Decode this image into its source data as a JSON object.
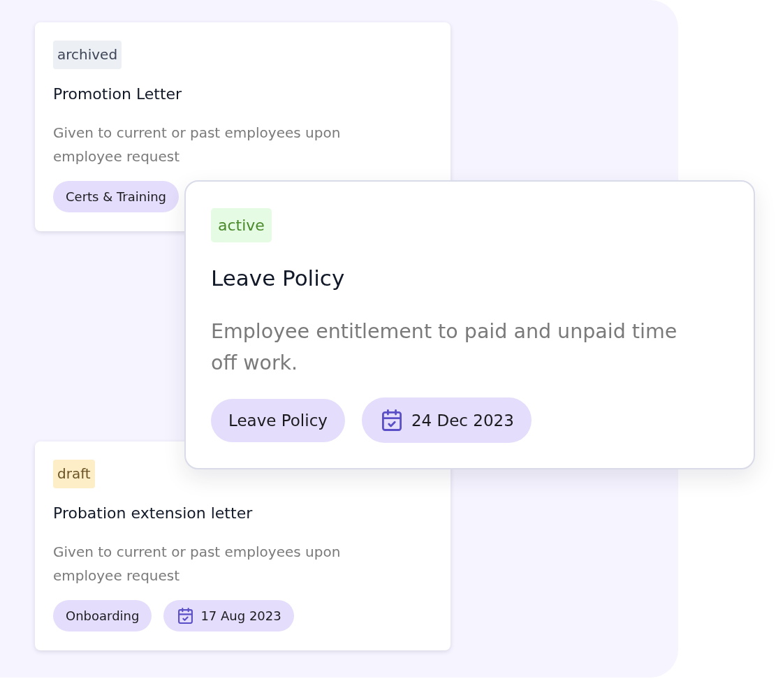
{
  "cards": [
    {
      "kind": "compact",
      "status": {
        "label": "archived",
        "kind": "neutral"
      },
      "title": "Promotion Letter",
      "description": "Given to current or past employees upon employee request",
      "tags": [
        {
          "kind": "category",
          "label": "Certs & Training"
        }
      ]
    },
    {
      "kind": "popout",
      "status": {
        "label": "active",
        "kind": "success"
      },
      "title": "Leave Policy",
      "description": "Employee entitlement to paid and unpaid time off work.",
      "tags": [
        {
          "kind": "category",
          "label": "Leave Policy"
        },
        {
          "kind": "date",
          "label": "24 Dec 2023"
        }
      ]
    },
    {
      "kind": "compact",
      "status": {
        "label": "draft",
        "kind": "warning"
      },
      "title": "Probation extension letter",
      "description": "Given to current or past employees upon employee request",
      "tags": [
        {
          "kind": "category",
          "label": "Onboarding"
        },
        {
          "kind": "date",
          "label": "17 Aug 2023"
        }
      ]
    }
  ]
}
